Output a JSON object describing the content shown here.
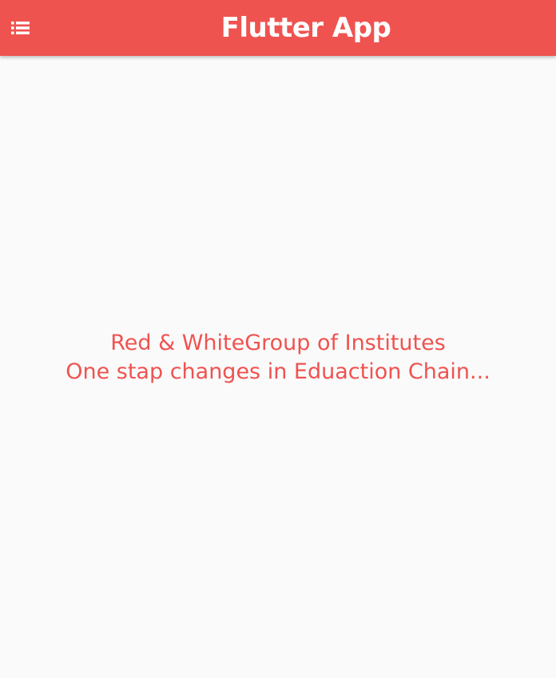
{
  "appbar": {
    "title": "Flutter App",
    "menu_icon": "list-icon",
    "background_color": "#ef5350",
    "title_color": "#ffffff"
  },
  "body": {
    "line1": "Red & WhiteGroup of Institutes",
    "line2": "One stap changes in Eduaction Chain...",
    "text_color": "#ef5350",
    "background_color": "#fafafa"
  }
}
